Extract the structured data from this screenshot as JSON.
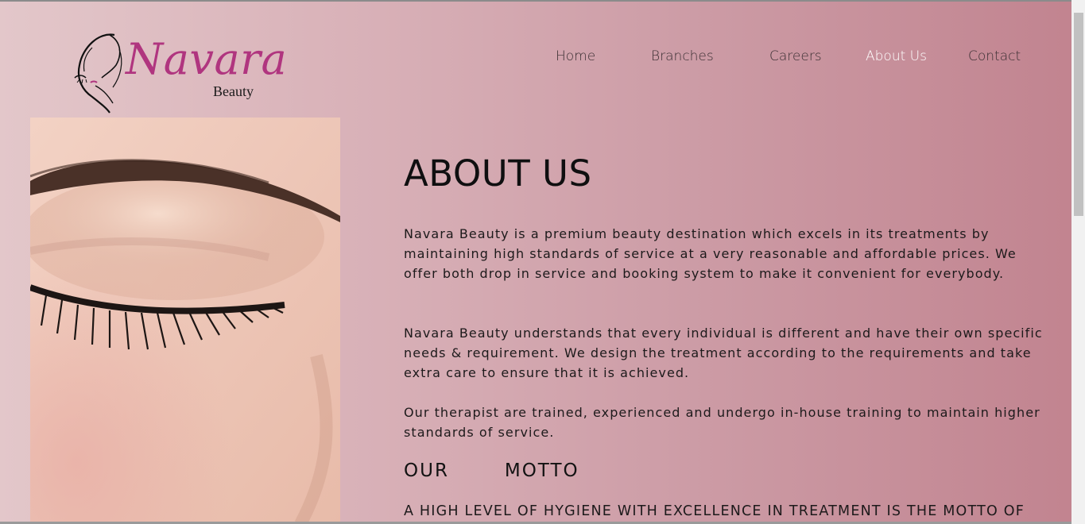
{
  "brand": {
    "name": "Navara",
    "subtitle": "Beauty"
  },
  "nav": {
    "items": [
      {
        "label": "Home",
        "active": false
      },
      {
        "label": "Branches",
        "active": false
      },
      {
        "label": "Careers",
        "active": false
      },
      {
        "label": "About Us",
        "active": true
      },
      {
        "label": "Contact",
        "active": false
      }
    ]
  },
  "about": {
    "title": "ABOUT US",
    "paragraphs": [
      "Navara Beauty is a premium beauty destination which excels in its treatments by maintaining high standards of service at a very reasonable and affordable prices. We offer both drop in service and booking system to make it convenient for everybody.",
      "Navara Beauty understands that every individual is different and have their own specific needs & requirement. We design the treatment according to the requirements and take extra care to ensure that it is achieved.",
      "Our therapist are trained, experienced and undergo in-house training to maintain higher standards of service."
    ],
    "motto_title": "OUR   MOTTO",
    "motto_text": "A HIGH LEVEL OF HYGIENE WITH EXCELLENCE IN TREATMENT IS THE MOTTO OF"
  },
  "colors": {
    "brand": "#b0357f",
    "active_nav": "#ffffff",
    "text": "#1d1a1b"
  }
}
